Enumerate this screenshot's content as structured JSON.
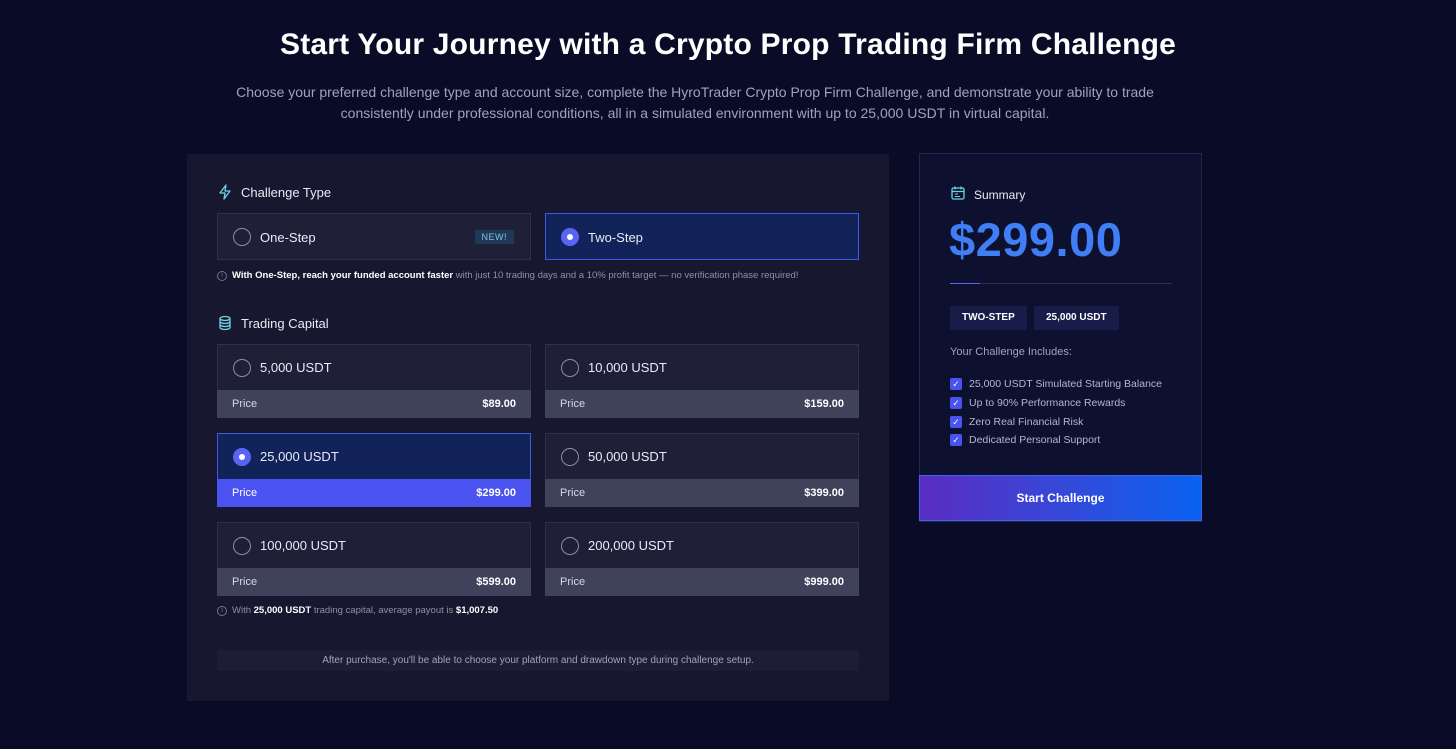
{
  "hero": {
    "title": "Start Your Journey with a Crypto Prop Trading Firm Challenge",
    "subtitle": "Choose your preferred challenge type and account size, complete the HyroTrader Crypto Prop Firm Challenge, and demonstrate your ability to trade consistently under professional conditions, all in a simulated environment with up to 25,000 USDT in virtual capital."
  },
  "challenge_type": {
    "title": "Challenge Type",
    "icon": "lightning-icon",
    "options": [
      {
        "label": "One-Step",
        "badge": "NEW!",
        "selected": false
      },
      {
        "label": "Two-Step",
        "selected": true
      }
    ],
    "note_bold": "With One-Step, reach your funded account faster",
    "note_rest": " with just 10 trading days and a 10% profit target — no verification phase required!"
  },
  "trading_capital": {
    "title": "Trading Capital",
    "icon": "coins-icon",
    "price_label": "Price",
    "options": [
      {
        "label": "5,000 USDT",
        "price": "$89.00",
        "selected": false
      },
      {
        "label": "10,000 USDT",
        "price": "$159.00",
        "selected": false
      },
      {
        "label": "25,000 USDT",
        "price": "$299.00",
        "selected": true
      },
      {
        "label": "50,000 USDT",
        "price": "$399.00",
        "selected": false
      },
      {
        "label": "100,000 USDT",
        "price": "$599.00",
        "selected": false
      },
      {
        "label": "200,000 USDT",
        "price": "$999.00",
        "selected": false
      }
    ],
    "payout_note": {
      "prefix": "With ",
      "capital": "25,000 USDT",
      "middle": " trading capital, average payout is ",
      "amount": "$1,007.50"
    }
  },
  "footer_note": "After purchase, you'll be able to choose your platform and drawdown type during challenge setup.",
  "summary": {
    "title": "Summary",
    "icon": "calendar-icon",
    "price": "$299.00",
    "chips": [
      "TWO-STEP",
      "25,000 USDT"
    ],
    "includes_title": "Your Challenge Includes:",
    "includes": [
      "25,000 USDT Simulated Starting Balance",
      "Up to 90% Performance Rewards",
      "Zero Real Financial Risk",
      "Dedicated Personal Support"
    ],
    "cta": "Start Challenge"
  },
  "colors": {
    "background": "#0a0c27",
    "accent": "#4a53f0",
    "price": "#3f7ef5"
  }
}
